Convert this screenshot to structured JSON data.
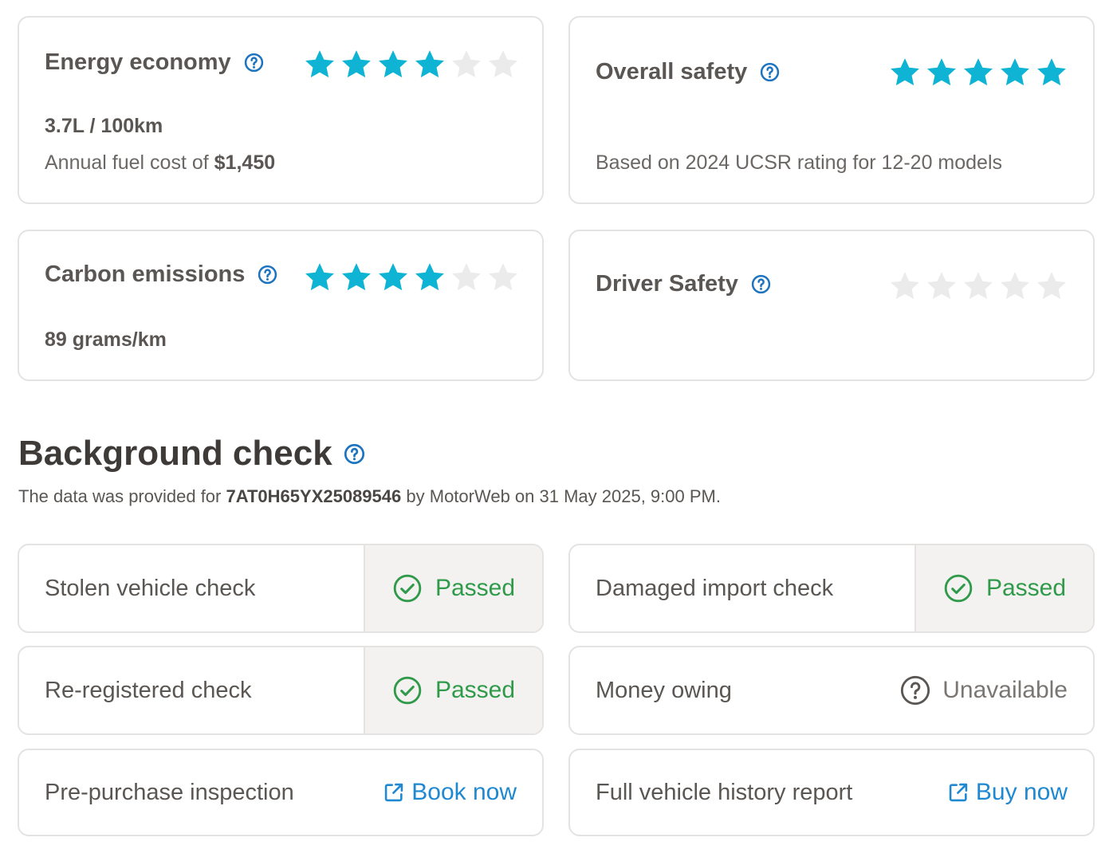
{
  "ratings": {
    "energy": {
      "title": "Energy economy",
      "stars_filled": 4,
      "stars_total": 6,
      "value": "3.7L / 100km",
      "sub_prefix": "Annual fuel cost of",
      "sub_value": "$1,450"
    },
    "overall_safety": {
      "title": "Overall safety",
      "stars_filled": 5,
      "stars_total": 5,
      "sub": "Based on 2024 UCSR rating for 12-20 models"
    },
    "carbon": {
      "title": "Carbon emissions",
      "stars_filled": 4,
      "stars_total": 6,
      "value": "89 grams/km"
    },
    "driver_safety": {
      "title": "Driver Safety",
      "stars_filled": 0,
      "stars_total": 5
    }
  },
  "background": {
    "title": "Background check",
    "provided_prefix": "The data was provided for",
    "plate": "7AT0H65YX25089546",
    "provided_suffix": "by MotorWeb on 31 May 2025, 9:00 PM."
  },
  "checks": {
    "stolen": {
      "label": "Stolen vehicle check",
      "status": "Passed"
    },
    "damaged": {
      "label": "Damaged import check",
      "status": "Passed"
    },
    "reregistered": {
      "label": "Re-registered check",
      "status": "Passed"
    },
    "money": {
      "label": "Money owing",
      "status": "Unavailable"
    },
    "inspection": {
      "label": "Pre-purchase inspection",
      "action": "Book now"
    },
    "history": {
      "label": "Full vehicle history report",
      "action": "Buy now"
    }
  },
  "colors": {
    "star_filled": "#0fb4d4",
    "star_empty": "#ebebeb",
    "help_blue": "#1c74c0",
    "passed_green": "#2f9a4a",
    "link_blue": "#1e88d0"
  },
  "icons": {
    "help": "question-circle-icon",
    "star": "star-icon",
    "passed": "check-circle-icon",
    "unavailable": "question-circle-icon",
    "external": "external-link-icon"
  }
}
